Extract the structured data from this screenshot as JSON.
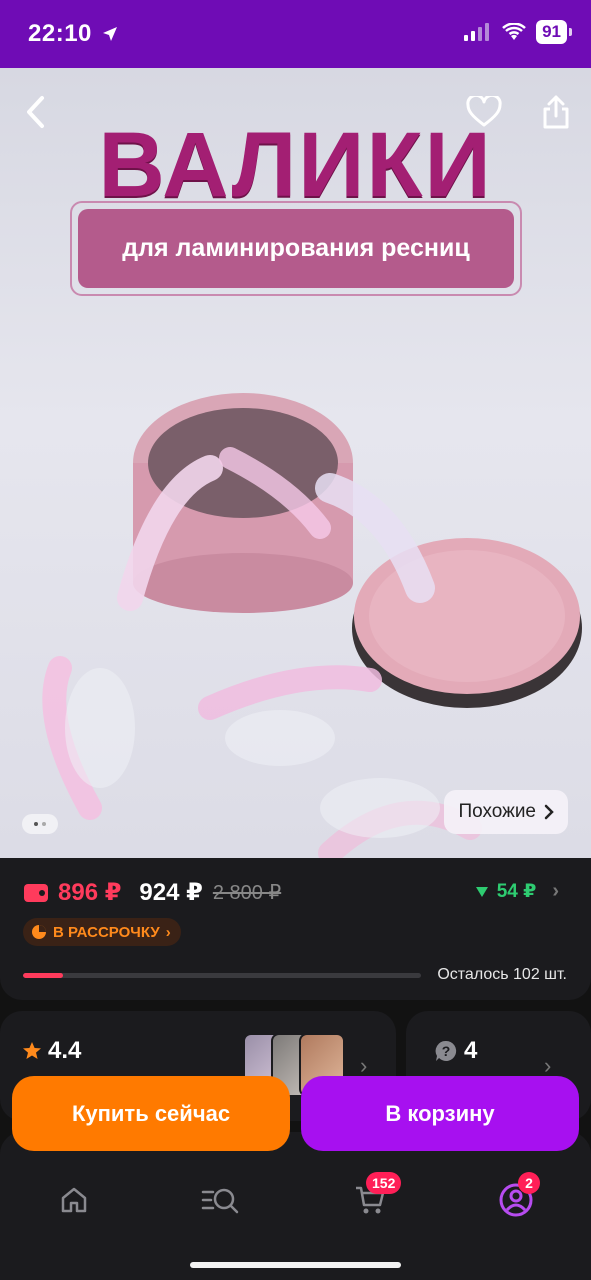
{
  "status_bar": {
    "time": "22:10",
    "battery": "91"
  },
  "product_image": {
    "title": "ВАЛИКИ",
    "subtitle": "для ламинирования ресниц",
    "similar_label": "Похожие"
  },
  "price": {
    "card_price": "896 ₽",
    "price": "924 ₽",
    "old_price": "2 800 ₽",
    "bonus": "54 ₽",
    "installment": "В РАССРОЧКУ",
    "stock_text": "Осталось 102 шт.",
    "stock_bar_fraction": 0.1
  },
  "rating": {
    "value": "4.4"
  },
  "questions": {
    "count": "4"
  },
  "actions": {
    "buy_now": "Купить сейчас",
    "add_to_cart": "В корзину"
  },
  "nav": {
    "cart_badge": "152",
    "profile_badge": "2"
  },
  "colors": {
    "accent_purple": "#a710f0",
    "accent_orange": "#ff7a00",
    "price_red": "#ff3b5c",
    "bonus_green": "#2ecc71"
  }
}
